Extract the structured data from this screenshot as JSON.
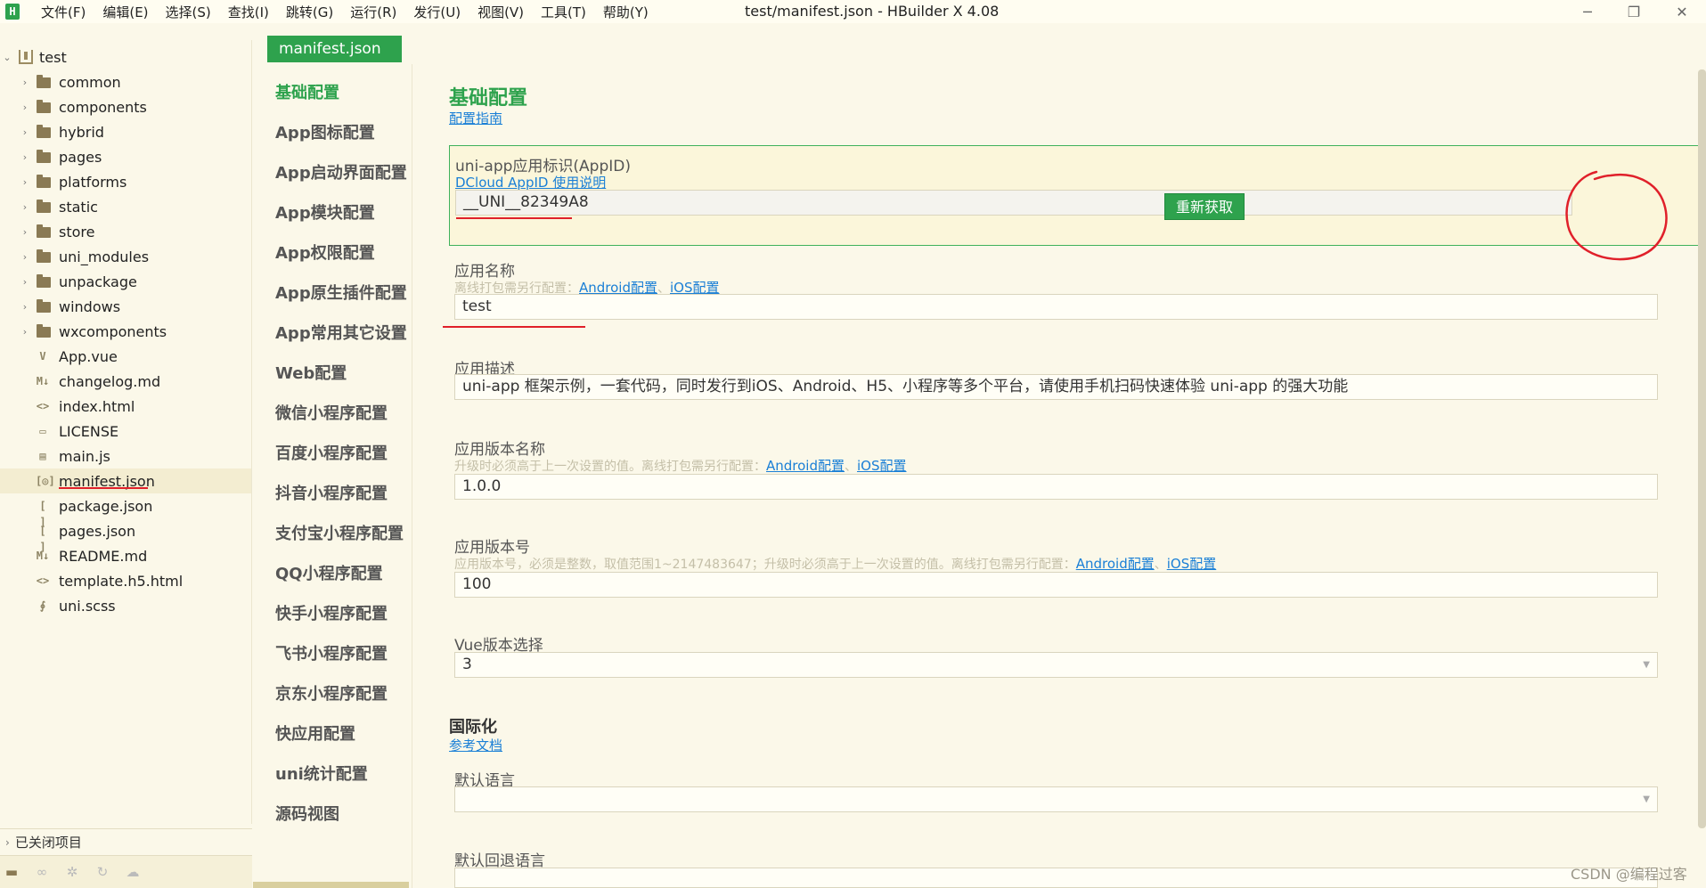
{
  "titlebar": {
    "menus": [
      "文件(F)",
      "编辑(E)",
      "选择(S)",
      "查找(I)",
      "跳转(G)",
      "运行(R)",
      "发行(U)",
      "视图(V)",
      "工具(T)",
      "帮助(Y)"
    ],
    "window_title": "test/manifest.json - HBuilder X 4.08"
  },
  "explorer": {
    "project": "test",
    "items": [
      {
        "label": "common",
        "type": "folder"
      },
      {
        "label": "components",
        "type": "folder"
      },
      {
        "label": "hybrid",
        "type": "folder"
      },
      {
        "label": "pages",
        "type": "folder"
      },
      {
        "label": "platforms",
        "type": "folder"
      },
      {
        "label": "static",
        "type": "folder"
      },
      {
        "label": "store",
        "type": "folder"
      },
      {
        "label": "uni_modules",
        "type": "folder"
      },
      {
        "label": "unpackage",
        "type": "folder"
      },
      {
        "label": "windows",
        "type": "folder"
      },
      {
        "label": "wxcomponents",
        "type": "folder"
      },
      {
        "label": "App.vue",
        "type": "file"
      },
      {
        "label": "changelog.md",
        "type": "file"
      },
      {
        "label": "index.html",
        "type": "file"
      },
      {
        "label": "LICENSE",
        "type": "file"
      },
      {
        "label": "main.js",
        "type": "file"
      },
      {
        "label": "manifest.json",
        "type": "file"
      },
      {
        "label": "package.json",
        "type": "file"
      },
      {
        "label": "pages.json",
        "type": "file"
      },
      {
        "label": "README.md",
        "type": "file"
      },
      {
        "label": "template.h5.html",
        "type": "file"
      },
      {
        "label": "uni.scss",
        "type": "file"
      }
    ],
    "closed_projects": "已关闭项目"
  },
  "tab": {
    "label": "manifest.json"
  },
  "nav": [
    "基础配置",
    "App图标配置",
    "App启动界面配置",
    "App模块配置",
    "App权限配置",
    "App原生插件配置",
    "App常用其它设置",
    "Web配置",
    "微信小程序配置",
    "百度小程序配置",
    "抖音小程序配置",
    "支付宝小程序配置",
    "QQ小程序配置",
    "快手小程序配置",
    "飞书小程序配置",
    "京东小程序配置",
    "快应用配置",
    "uni统计配置",
    "源码视图"
  ],
  "form": {
    "section_title": "基础配置",
    "guide_link": "配置指南",
    "appid": {
      "label": "uni-app应用标识(AppID)",
      "link": "DCloud AppID 使用说明",
      "value": "__UNI__82349A8",
      "button": "重新获取"
    },
    "app_name": {
      "label": "应用名称",
      "hint": "离线打包需另行配置：",
      "link_android": "Android配置",
      "sep": "、",
      "link_ios": "iOS配置",
      "value": "test"
    },
    "app_desc": {
      "label": "应用描述",
      "value": "uni-app 框架示例，一套代码，同时发行到iOS、Android、H5、小程序等多个平台，请使用手机扫码快速体验 uni-app 的强大功能"
    },
    "version_name": {
      "label": "应用版本名称",
      "hint": "升级时必须高于上一次设置的值。离线打包需另行配置：",
      "link_android": "Android配置",
      "sep": "、",
      "link_ios": "iOS配置",
      "value": "1.0.0"
    },
    "version_code": {
      "label": "应用版本号",
      "hint": "应用版本号，必须是整数，取值范围1~2147483647；升级时必须高于上一次设置的值。离线打包需另行配置：",
      "link_android": "Android配置",
      "sep": "、",
      "link_ios": "iOS配置",
      "value": "100"
    },
    "vue_version": {
      "label": "Vue版本选择",
      "value": "3"
    },
    "i18n": {
      "title": "国际化",
      "link": "参考文档",
      "default_lang_label": "默认语言",
      "default_lang_value": "",
      "fallback_lang_label": "默认回退语言"
    }
  },
  "watermark": "CSDN @编程过客"
}
